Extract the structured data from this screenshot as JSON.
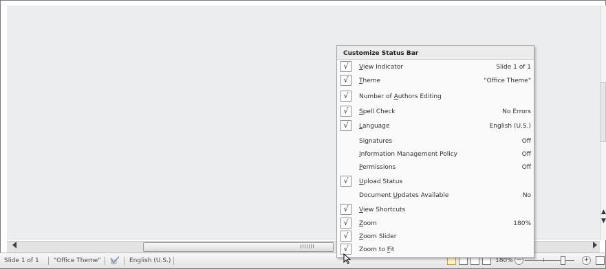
{
  "status_bar": {
    "slide": "Slide 1 of 1",
    "theme": "\"Office Theme\"",
    "language": "English (U.S.)",
    "zoom": "180%",
    "minus": "−",
    "plus": "+"
  },
  "menu": {
    "title": "Customize Status Bar",
    "items": [
      {
        "pre": "",
        "u": "V",
        "post": "iew Indicator",
        "value": "Slide 1 of 1",
        "checked": true
      },
      {
        "pre": "",
        "u": "T",
        "post": "heme",
        "value": "\"Office Theme\"",
        "checked": true
      },
      {
        "pre": "Number of ",
        "u": "A",
        "post": "uthors Editing",
        "value": "",
        "checked": true
      },
      {
        "pre": "",
        "u": "S",
        "post": "pell Check",
        "value": "No Errors",
        "checked": true
      },
      {
        "pre": "",
        "u": "L",
        "post": "anguage",
        "value": "English (U.S.)",
        "checked": true
      },
      {
        "pre": "Si",
        "u": "g",
        "post": "natures",
        "value": "Off",
        "checked": false
      },
      {
        "pre": "",
        "u": "I",
        "post": "nformation Management Policy",
        "value": "Off",
        "checked": false
      },
      {
        "pre": "",
        "u": "P",
        "post": "ermissions",
        "value": "Off",
        "checked": false
      },
      {
        "pre": "",
        "u": "U",
        "post": "pload Status",
        "value": "",
        "checked": true
      },
      {
        "pre": "Document ",
        "u": "U",
        "post": "pdates Available",
        "value": "No",
        "checked": false
      },
      {
        "pre": "",
        "u": "V",
        "post": "iew Shortcuts",
        "value": "",
        "checked": true
      },
      {
        "pre": "",
        "u": "Z",
        "post": "oom",
        "value": "180%",
        "checked": true
      },
      {
        "pre": "",
        "u": "Z",
        "post": "oom Slider",
        "value": "",
        "checked": true
      },
      {
        "pre": "Zoom to ",
        "u": "F",
        "post": "it",
        "value": "",
        "checked": true
      }
    ],
    "check_glyph": "√"
  }
}
